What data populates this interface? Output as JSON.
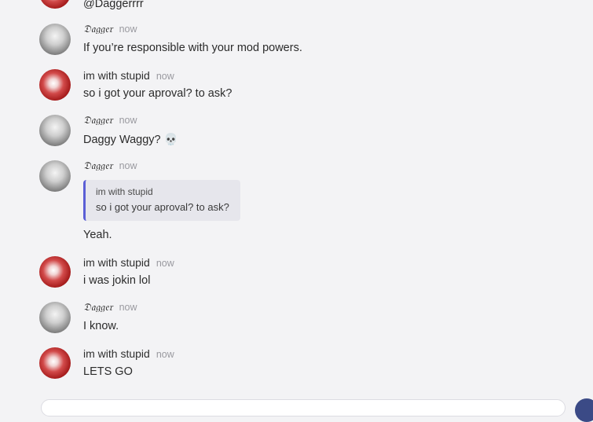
{
  "messages": [
    {
      "author": "",
      "time": "",
      "text": "@Daggerrrr",
      "avatar": "stupid-avatar-icon"
    },
    {
      "author": "𝔇𝔞𝔤𝔤𝔢𝔯",
      "time": "now",
      "text": "If you’re responsible with your mod powers.",
      "avatar": "dagger-avatar-icon"
    },
    {
      "author": "im with stupid",
      "time": "now",
      "text": "so i got your aproval? to ask?",
      "avatar": "stupid-avatar-icon"
    },
    {
      "author": "𝔇𝔞𝔤𝔤𝔢𝔯",
      "time": "now",
      "text": "Daggy Waggy? 💀",
      "avatar": "dagger-avatar-icon"
    },
    {
      "author": "𝔇𝔞𝔤𝔤𝔢𝔯",
      "time": "now",
      "quote_author": "im with stupid",
      "quote_text": "so i got your aproval? to ask?",
      "text": "Yeah.",
      "avatar": "dagger-avatar-icon"
    },
    {
      "author": "im with stupid",
      "time": "now",
      "text": "i was jokin lol",
      "avatar": "stupid-avatar-icon"
    },
    {
      "author": "𝔇𝔞𝔤𝔤𝔢𝔯",
      "time": "now",
      "text": "I know.",
      "avatar": "dagger-avatar-icon"
    },
    {
      "author": "im with stupid",
      "time": "now",
      "text": "LETS GO",
      "avatar": "stupid-avatar-icon"
    }
  ],
  "colors": {
    "background": "#f3f3f5",
    "quote_bar": "#5b5fd6",
    "timestamp": "#9a9aa0",
    "send_button": "#3b4a86"
  }
}
